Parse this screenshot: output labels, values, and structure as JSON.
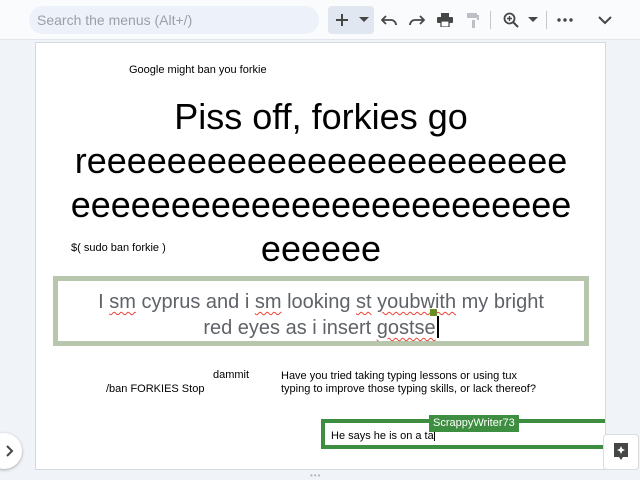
{
  "toolbar": {
    "search_placeholder": "Search the menus (Alt+/)",
    "buttons": [
      "new-slide",
      "insert-dropdown",
      "undo",
      "redo",
      "print",
      "paint-format",
      "zoom",
      "zoom-dropdown",
      "more",
      "collapse"
    ]
  },
  "slide": {
    "text_top_small": "Google might ban you forkie",
    "title_lines": [
      "Piss off, forkies go",
      "reeeeeeeeeeeeeeeeeeeeeeee",
      "eeeeeeeeeeeeeeeeeeeeeeeee",
      "eeeeee"
    ],
    "sudo_text": "$( sudo ban forkie )",
    "focus_lines": {
      "line1_parts": [
        "I ",
        "sm",
        " ",
        "cyprus",
        " and  i ",
        "sm",
        " looking ",
        "st",
        " ",
        "youbwith",
        " my bright"
      ],
      "line2_parts": [
        "red eyes as i insert ",
        "gostse"
      ]
    },
    "dammit": "dammit",
    "ban_line": "/ban FORKIES Stop",
    "typing_lines": [
      "Have you tried taking typing lessons or using tux",
      "typing to improve those typing skills, or lack thereof?"
    ],
    "collab_text": "He says he is on a ta",
    "collab_name": "ScrappyWriter73"
  },
  "colors": {
    "focus_border": "#b7c6ac",
    "collab_border": "#3e8e41",
    "spellcheck": "#ea4335"
  }
}
